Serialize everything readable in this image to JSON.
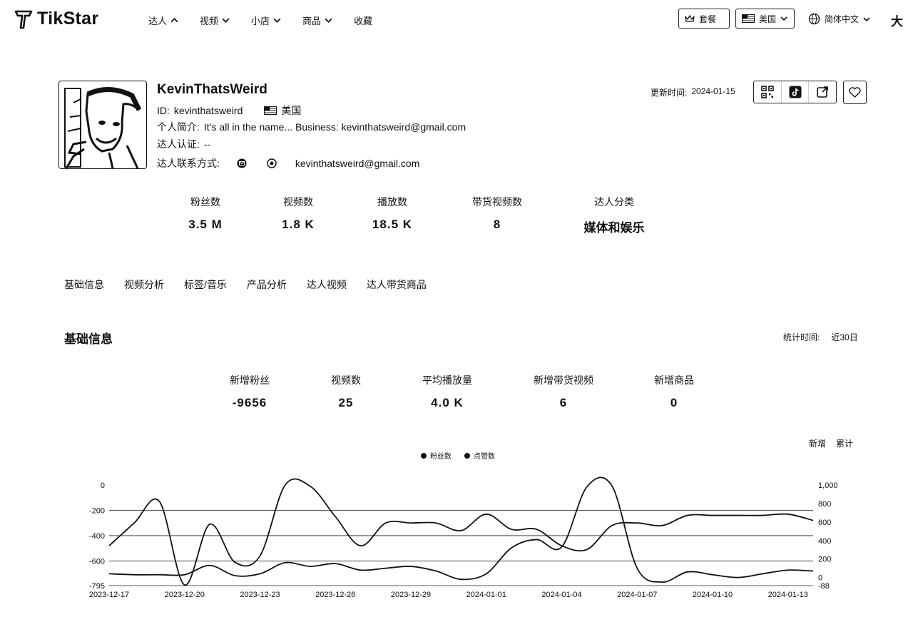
{
  "header": {
    "logo_text": "TikStar",
    "nav": [
      {
        "label": "达人",
        "caret": "up"
      },
      {
        "label": "视频",
        "caret": "down"
      },
      {
        "label": "小店",
        "caret": "down"
      },
      {
        "label": "商品",
        "caret": "down"
      },
      {
        "label": "收藏",
        "caret": ""
      }
    ],
    "plan_label": "套餐",
    "region_label": "美国",
    "language_label": "简体中文",
    "right_char": "大"
  },
  "profile": {
    "name": "KevinThatsWeird",
    "id_label": "ID:",
    "id_value": "kevinthatsweird",
    "country": "美国",
    "bio_label": "个人简介:",
    "bio_value": "It’s all in the name... Business: kevinthatsweird@gmail.com",
    "verify_label": "达人认证:",
    "verify_value": "--",
    "contact_label": "达人联系方式:",
    "contact_email": "kevinthatsweird@gmail.com",
    "update_label": "更新时间:",
    "update_value": "2024-01-15"
  },
  "stats": [
    {
      "label": "粉丝数",
      "value": "3.5 M"
    },
    {
      "label": "视频数",
      "value": "1.8 K"
    },
    {
      "label": "播放数",
      "value": "18.5 K"
    },
    {
      "label": "带货视频数",
      "value": "8"
    },
    {
      "label": "达人分类",
      "value": "媒体和娱乐"
    }
  ],
  "tabs": [
    "基础信息",
    "视频分析",
    "标签/音乐",
    "产品分析",
    "达人视频",
    "达人带货商品"
  ],
  "basic": {
    "title": "基础信息",
    "stat_time_label": "统计时间:",
    "stat_time_value": "近30日",
    "metrics": [
      {
        "label": "新增粉丝",
        "value": "-9656"
      },
      {
        "label": "视频数",
        "value": "25"
      },
      {
        "label": "平均播放量",
        "value": "4.0 K"
      },
      {
        "label": "新增带货视频",
        "value": "6"
      },
      {
        "label": "新增商品",
        "value": "0"
      }
    ],
    "toggle_new": "新增",
    "toggle_cumulative": "累计"
  },
  "chart_data": {
    "type": "line",
    "legend": [
      "粉丝数",
      "点赞数"
    ],
    "x": [
      "2023-12-17",
      "2023-12-18",
      "2023-12-19",
      "2023-12-20",
      "2023-12-21",
      "2023-12-22",
      "2023-12-23",
      "2023-12-24",
      "2023-12-25",
      "2023-12-26",
      "2023-12-27",
      "2023-12-28",
      "2023-12-29",
      "2023-12-30",
      "2023-12-31",
      "2024-01-01",
      "2024-01-02",
      "2024-01-03",
      "2024-01-04",
      "2024-01-05",
      "2024-01-06",
      "2024-01-07",
      "2024-01-08",
      "2024-01-09",
      "2024-01-10",
      "2024-01-11",
      "2024-01-12",
      "2024-01-13",
      "2024-01-14"
    ],
    "x_tick_labels": [
      "2023-12-17",
      "2023-12-20",
      "2023-12-23",
      "2023-12-26",
      "2023-12-29",
      "2024-01-01",
      "2024-01-04",
      "2024-01-07",
      "2024-01-10",
      "2024-01-13"
    ],
    "y_left": {
      "ticks": [
        "0",
        "-200",
        "-400",
        "-600",
        "-795"
      ],
      "range": [
        -795,
        0
      ]
    },
    "y_right": {
      "ticks": [
        "1,000",
        "800",
        "600",
        "400",
        "200",
        "0",
        "-88"
      ],
      "range": [
        -88,
        1000
      ]
    },
    "series": [
      {
        "name": "粉丝数",
        "axis": "left",
        "values": [
          -480,
          -300,
          -130,
          -790,
          -310,
          -610,
          -560,
          0,
          -10,
          -250,
          -480,
          -300,
          -300,
          -300,
          -360,
          -230,
          -350,
          -350,
          -480,
          -510,
          -320,
          -300,
          -320,
          -240,
          -240,
          -240,
          -240,
          -230,
          -280
        ]
      },
      {
        "name": "点赞数",
        "axis": "right",
        "values": [
          40,
          30,
          30,
          30,
          130,
          20,
          40,
          160,
          120,
          150,
          80,
          100,
          120,
          70,
          -20,
          40,
          320,
          410,
          330,
          980,
          990,
          100,
          -50,
          60,
          30,
          0,
          40,
          80,
          70
        ]
      }
    ]
  }
}
